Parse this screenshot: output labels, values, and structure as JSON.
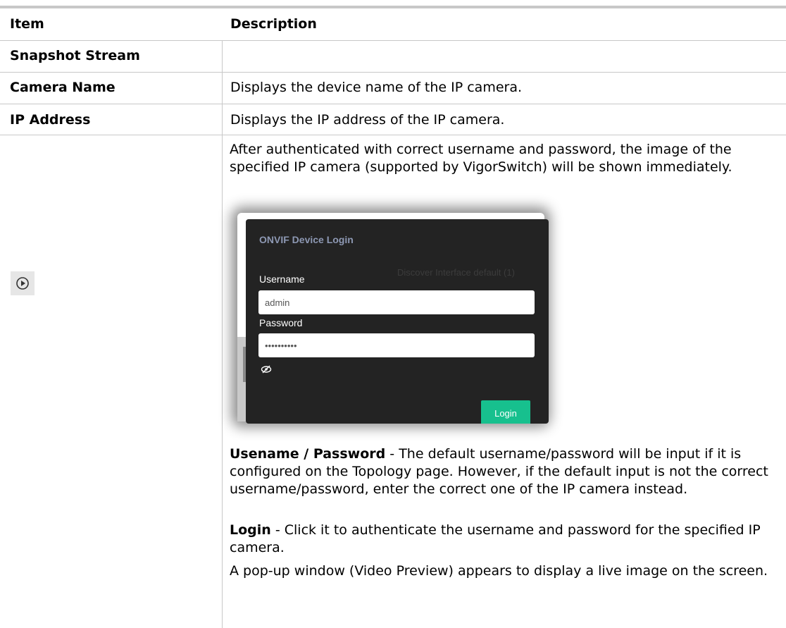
{
  "header": {
    "item": "Item",
    "description": "Description"
  },
  "section": "Snapshot Stream",
  "rows": [
    {
      "item": "Camera Name",
      "description": "Displays the device name of the IP camera."
    },
    {
      "item": "IP Address",
      "description": "Displays the IP address of the IP camera."
    }
  ],
  "play_row": {
    "icon": "play-circle-icon",
    "intro": "After authenticated with correct username and password, the image of the specified IP camera (supported by VigorSwitch) will be shown immediately.",
    "dialog": {
      "title": "ONVIF Device Login",
      "ghost_text": "Discover Interface    default (1)",
      "username_label": "Username",
      "username_value": "admin",
      "password_label": "Password",
      "password_value": "••••••••••",
      "eye_icon": "eye-slash-icon",
      "login_button": "Login",
      "login_color": "#17c08e"
    },
    "notes": [
      {
        "term": "Usename / Password",
        "text": " - The default username/password will be input if it is configured on the Topology page. However, if the default input is not the correct username/password, enter the correct one of the IP camera instead."
      },
      {
        "term": "Login",
        "text": " - Click it to authenticate the username and password for the specified IP camera."
      }
    ],
    "outro": "A pop-up window (Video Preview) appears to display a live image on the screen."
  }
}
